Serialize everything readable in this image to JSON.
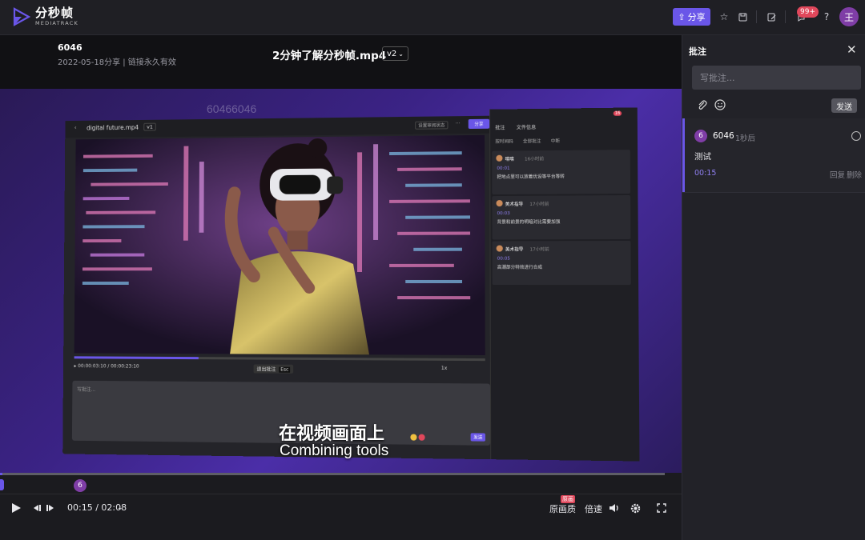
{
  "app": {
    "name": "分秒帧",
    "sub": "MEDIATRACK"
  },
  "topbar": {
    "share_label": "分享",
    "notification_count": "99+",
    "avatar_initial": "王",
    "help_label": "?"
  },
  "file": {
    "owner": "6046",
    "share_info": "2022-05-18分享 | 链接永久有效",
    "title": "2分钟了解分秒帧.mp4",
    "version": "v2"
  },
  "video": {
    "watermark": "60466046",
    "subtitle_cn": "在视频画面上",
    "subtitle_en": "Combining tools"
  },
  "inner_screenshot": {
    "filename": "digital future.mp4",
    "version": "v1",
    "status_select": "设置审阅状态",
    "more": "···",
    "share": "分享",
    "tabs": [
      "批注",
      "文件信息"
    ],
    "filters": [
      "按时间码",
      "全部批注",
      "中断"
    ],
    "badge": "16",
    "time": "00:00:03:10 / 00:00:23:10",
    "exit_label": "退出批注",
    "exit_key": "Esc",
    "rate": "1x",
    "placeholder": "写批注...",
    "send": "发送",
    "comments": [
      {
        "name": "嘻嘻",
        "ago": "16小时前",
        "ts": "00:01",
        "text": "把地点里可以放着优设等平台等转"
      },
      {
        "name": "美术指导",
        "ago": "17小时前",
        "ts": "00:03",
        "text": "背景和前景的明暗对比需要加强"
      },
      {
        "name": "美术指导",
        "ago": "17小时前",
        "ts": "00:05",
        "text": "高潮部分特效进行合成"
      }
    ]
  },
  "player": {
    "time": "00:15 / 02:08",
    "quality": "原画质",
    "quality_tag": "原画",
    "speed": "倍速",
    "marker": "6",
    "progress": 0.117
  },
  "panel": {
    "title": "批注",
    "placeholder": "写批注...",
    "send_label": "发送",
    "comment": {
      "number": "6",
      "user": "6046",
      "time_ago": "1秒后",
      "text": "测试",
      "timestamp": "00:15",
      "reply": "回复",
      "delete": "删除"
    }
  },
  "colors": {
    "accent": "#6a56e8",
    "badge": "#e0475b",
    "avatar": "#7f3da6"
  }
}
